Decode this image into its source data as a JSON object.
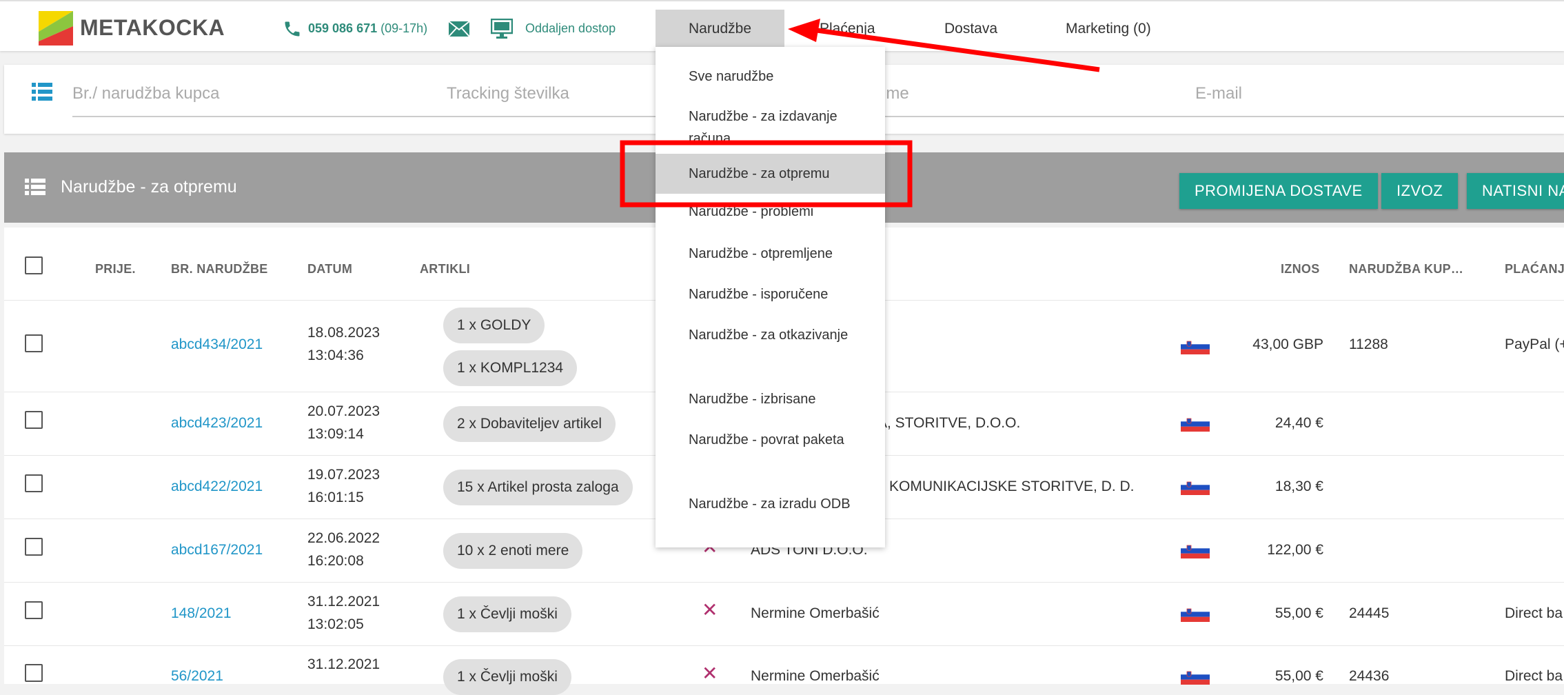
{
  "brand": {
    "name": "METAKOCKA"
  },
  "contact": {
    "phone": "059 086 671",
    "hours": "(09-17h)",
    "remote": "Oddaljen dostop"
  },
  "nav": {
    "orders": "Narudžbe",
    "payments": "Plaćenja",
    "delivery": "Dostava",
    "marketing": "Marketing (0)"
  },
  "dropdown": {
    "items": [
      "Sve narudžbe",
      "Narudžbe - za izdavanje računa",
      "Narudžbe - za otpremu",
      "Narudžbe - problemi",
      "Narudžbe - otpremljene",
      "Narudžbe - isporučene",
      "Narudžbe - za otkazivanje",
      "Narudžbe - izbrisane",
      "Narudžbe - povrat paketa",
      "Narudžbe - za izradu ODB"
    ]
  },
  "search": {
    "order_placeholder": "Br./ narudžba kupca",
    "tracking_placeholder": "Tracking številka",
    "name_placeholder": "zime",
    "email_placeholder": "E-mail"
  },
  "panel": {
    "title": "Narudžbe - za otpremu",
    "btn_change_delivery": "PROMIJENA DOSTAVE",
    "btn_export": "IZVOZ",
    "btn_print": "NATISNI NA"
  },
  "table": {
    "headers": {
      "prije": "PRIJE.",
      "order_no": "BR. NARUDŽBE",
      "date": "DATUM",
      "items": "ARTIKLI",
      "amount": "IZNOS",
      "customer_order": "NARUDŽBA KUP…",
      "payment": "PLAĆANJ"
    },
    "rows": [
      {
        "order": "abcd434/2021",
        "date": "18.08.2023",
        "time": "13:04:36",
        "item1": "1 x GOLDY",
        "item2": "1 x KOMPL1234",
        "customer": "",
        "amount": "43,00 GBP",
        "kupca": "11288",
        "payment": "PayPal (+"
      },
      {
        "order": "abcd423/2021",
        "date": "20.07.2023",
        "time": "13:09:14",
        "item1": "2 x Dobaviteljev artikel",
        "customer": "A, STORITVE, D.O.O.",
        "amount": "24,40 €",
        "kupca": "",
        "payment": ""
      },
      {
        "order": "abcd422/2021",
        "date": "19.07.2023",
        "time": "16:01:15",
        "item1": "15 x Artikel prosta zaloga",
        "customer": "KOMUNIKACIJSKE STORITVE, D. D.",
        "amount": "18,30 €",
        "kupca": "",
        "payment": ""
      },
      {
        "order": "abcd167/2021",
        "date": "22.06.2022",
        "time": "16:20:08",
        "item1": "10 x 2 enoti mere",
        "customer": "ADS TONI D.O.O.",
        "amount": "122,00 €",
        "kupca": "",
        "payment": ""
      },
      {
        "order": "148/2021",
        "date": "31.12.2021",
        "time": "13:02:05",
        "item1": "1 x Čevlji moški",
        "customer": "Nermine Omerbašić",
        "amount": "55,00 €",
        "kupca": "24445",
        "payment": "Direct ba"
      },
      {
        "order": "56/2021",
        "date": "31.12.2021",
        "time": "",
        "item1": "1 x Čevlji moški",
        "customer": "Nermine Omerbašić",
        "amount": "55,00 €",
        "kupca": "24436",
        "payment": "Direct ba"
      }
    ]
  },
  "colors": {
    "accent": "#1fa090",
    "link": "#2196c8",
    "header_gray": "#9e9e9e",
    "annotation": "#ff0000"
  }
}
